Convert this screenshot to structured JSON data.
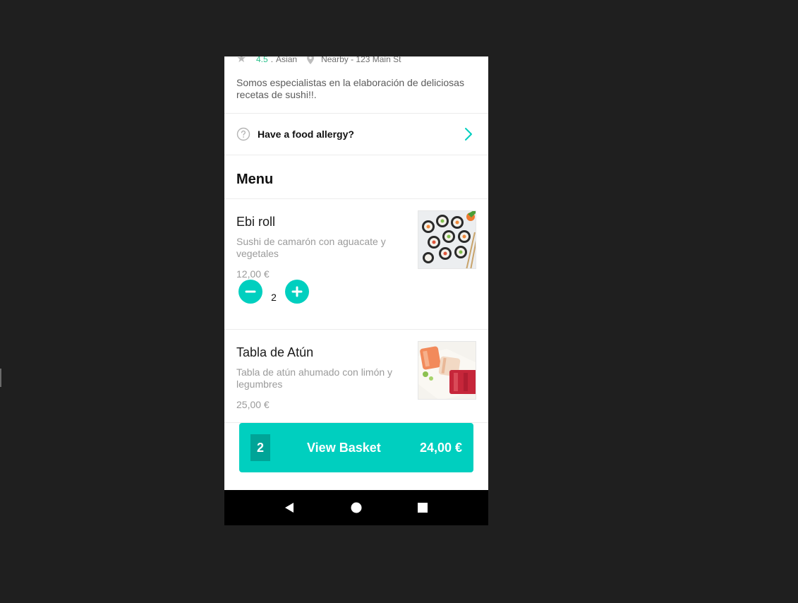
{
  "restaurant": {
    "rating": "4.5",
    "separator": ".",
    "cuisine": "Asian",
    "location": "Nearby - 123 Main St",
    "description": "Somos especialistas en la elaboración de deliciosas recetas de sushi!!."
  },
  "allergy": {
    "label": "Have a food allergy?"
  },
  "menu": {
    "title": "Menu",
    "items": [
      {
        "name": "Ebi roll",
        "description": "Sushi de camarón con aguacate y vegetales",
        "price": "12,00 €",
        "quantity": "2"
      },
      {
        "name": "Tabla de Atún",
        "description": "Tabla de atún ahumado con limón y legumbres",
        "price": "25,00 €"
      }
    ]
  },
  "basket": {
    "count": "2",
    "label": "View Basket",
    "total": "24,00 €"
  },
  "icons": {
    "rating": "star-icon",
    "location": "map-pin-icon",
    "allergy": "help-circle-icon",
    "allergy_action": "chevron-right-icon",
    "decrement": "minus-icon",
    "increment": "plus-icon",
    "nav_back": "triangle-back-icon",
    "nav_home": "circle-home-icon",
    "nav_recents": "square-recents-icon"
  },
  "colors": {
    "accent": "#00cfbf",
    "accent_dark": "#00a497",
    "rating": "#2cc18c",
    "background": "#1f1f1f"
  }
}
